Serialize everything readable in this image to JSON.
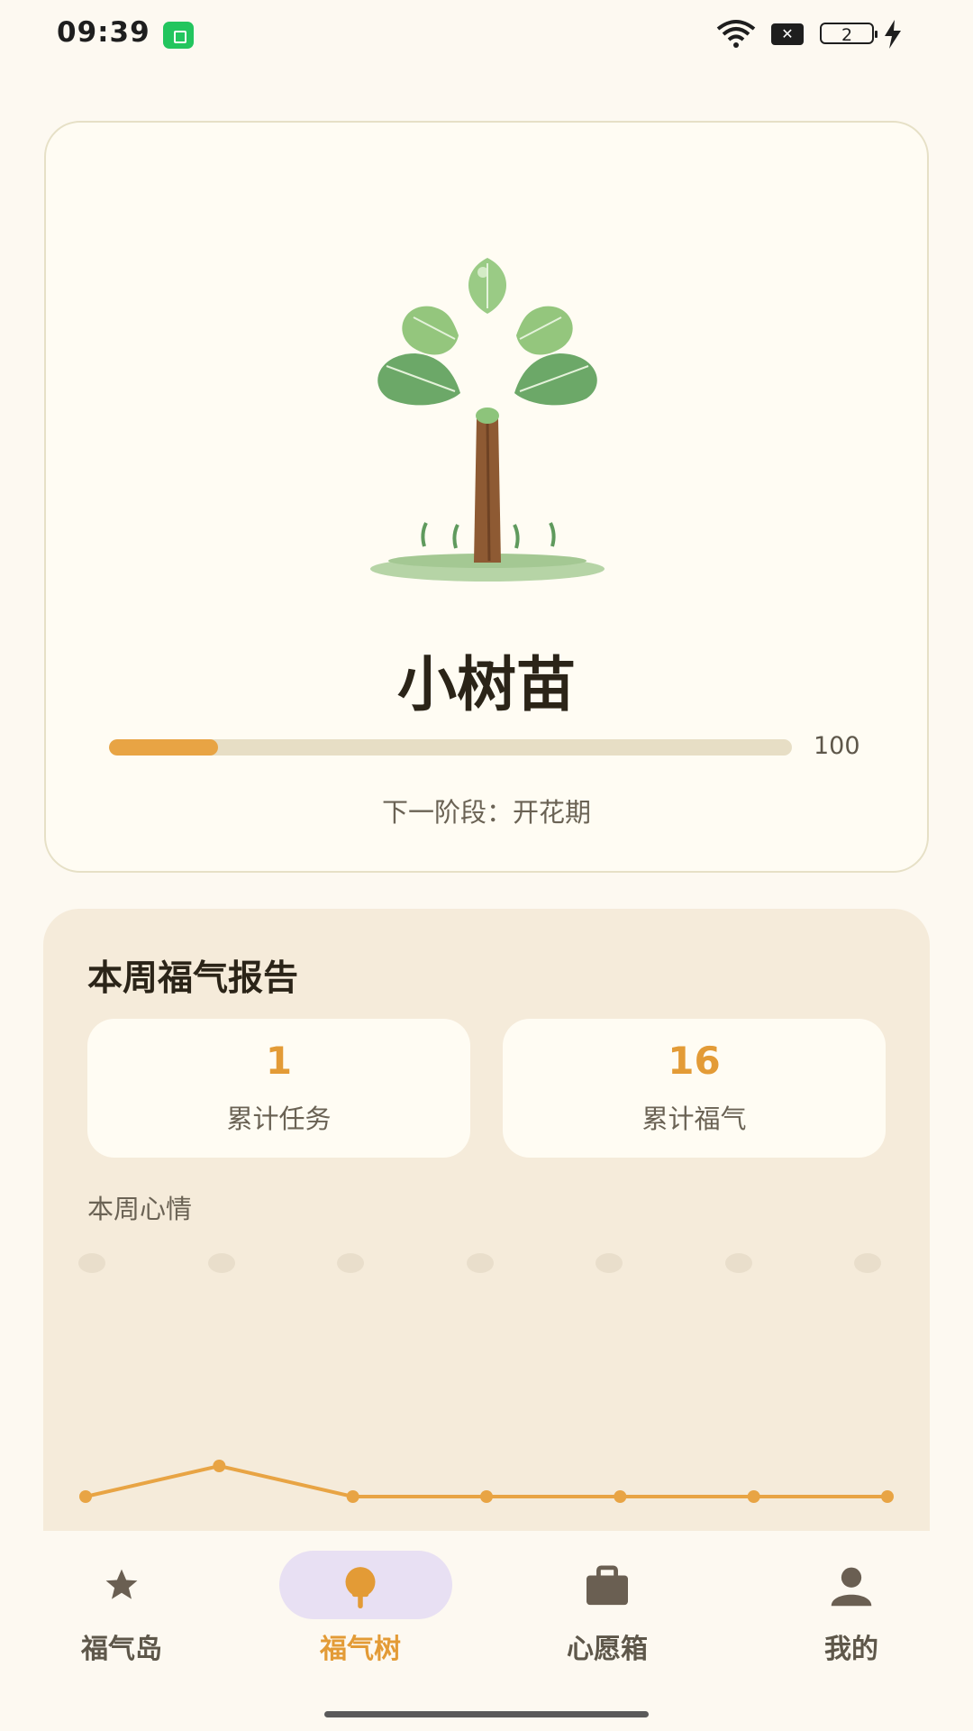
{
  "status_bar": {
    "time": "09:39",
    "battery_level": "2",
    "icons": [
      "app-notification-icon",
      "wifi-icon",
      "sim-disabled-icon",
      "battery-icon",
      "charging-bolt-icon"
    ]
  },
  "tree": {
    "stage_name": "小树苗",
    "progress_value_label": "100",
    "progress_fraction": 0.16,
    "next_stage": "下一阶段：开花期"
  },
  "weekly_report": {
    "title": "本周福气报告",
    "stats": [
      {
        "value": "1",
        "label": "累计任务"
      },
      {
        "value": "16",
        "label": "累计福气"
      }
    ],
    "mood_title": "本周心情",
    "mood_days": 7
  },
  "chart_data": {
    "type": "line",
    "series": [
      {
        "values": [
          0,
          1,
          0,
          0,
          0,
          0,
          0
        ]
      }
    ],
    "color": "#E8A444"
  },
  "nav": {
    "items": [
      {
        "label": "福气岛",
        "icon": "star-icon",
        "active": false
      },
      {
        "label": "福气树",
        "icon": "tree-icon",
        "active": true
      },
      {
        "label": "心愿箱",
        "icon": "briefcase-icon",
        "active": false
      },
      {
        "label": "我的",
        "icon": "person-icon",
        "active": false
      }
    ]
  },
  "colors": {
    "accent": "#E8A444",
    "background": "#FDF9F1",
    "card": "#F5EBDA",
    "active_pill": "#E8E0F3"
  }
}
